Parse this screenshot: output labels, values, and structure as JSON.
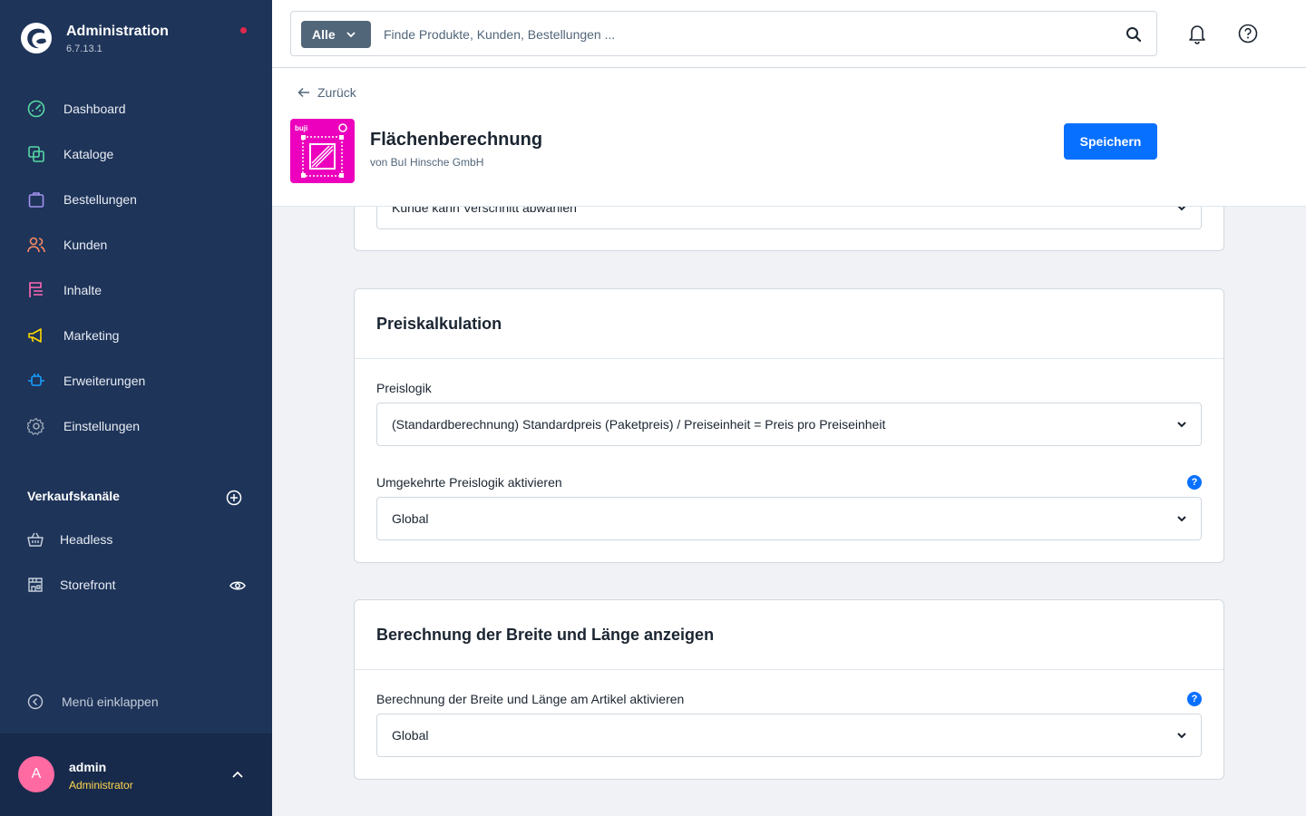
{
  "brand": {
    "title": "Administration",
    "version": "6.7.13.1"
  },
  "nav": {
    "items": [
      {
        "label": "Dashboard",
        "icon": "dashboard-icon",
        "color": "#57d9a3"
      },
      {
        "label": "Kataloge",
        "icon": "catalogue-icon",
        "color": "#57d9a3"
      },
      {
        "label": "Bestellungen",
        "icon": "bag-icon",
        "color": "#a092f0"
      },
      {
        "label": "Kunden",
        "icon": "users-icon",
        "color": "#f88962"
      },
      {
        "label": "Inhalte",
        "icon": "content-icon",
        "color": "#ff68b4"
      },
      {
        "label": "Marketing",
        "icon": "megaphone-icon",
        "color": "#ffd700"
      },
      {
        "label": "Erweiterungen",
        "icon": "plug-icon",
        "color": "#189eff"
      },
      {
        "label": "Einstellungen",
        "icon": "gear-icon",
        "color": "#9aa8b5"
      }
    ]
  },
  "sales_channels": {
    "title": "Verkaufskanäle",
    "items": [
      {
        "label": "Headless",
        "icon": "basket-icon"
      },
      {
        "label": "Storefront",
        "icon": "storefront-icon"
      }
    ]
  },
  "collapse_label": "Menü einklappen",
  "user": {
    "initial": "A",
    "name": "admin",
    "role": "Administrator"
  },
  "search": {
    "type": "Alle",
    "placeholder": "Finde Produkte, Kunden, Bestellungen ..."
  },
  "header": {
    "back_label": "Zurück",
    "plugin_title": "Flächenberechnung",
    "plugin_vendor": "von BuI Hinsche GmbH",
    "save_label": "Speichern",
    "plugin_icon_text": "buji"
  },
  "cards": {
    "top": {
      "select_value": "Kunde kann Verschnitt abwählen"
    },
    "price": {
      "title": "Preiskalkulation",
      "logic_label": "Preislogik",
      "logic_value": "(Standardberechnung) Standardpreis (Paketpreis) / Preiseinheit = Preis pro Preiseinheit",
      "reverse_label": "Umgekehrte Preislogik aktivieren",
      "reverse_value": "Global"
    },
    "dimensions": {
      "title": "Berechnung der Breite und Länge anzeigen",
      "enable_label": "Berechnung der Breite und Länge am Artikel aktivieren",
      "enable_value": "Global"
    }
  },
  "help_glyph": "?",
  "colors": {
    "sidebar": "#1e3459",
    "primary": "#0870ff",
    "plugin_icon": "#ec00bd",
    "avatar": "#ff6aa3",
    "role": "#ffd84a"
  }
}
